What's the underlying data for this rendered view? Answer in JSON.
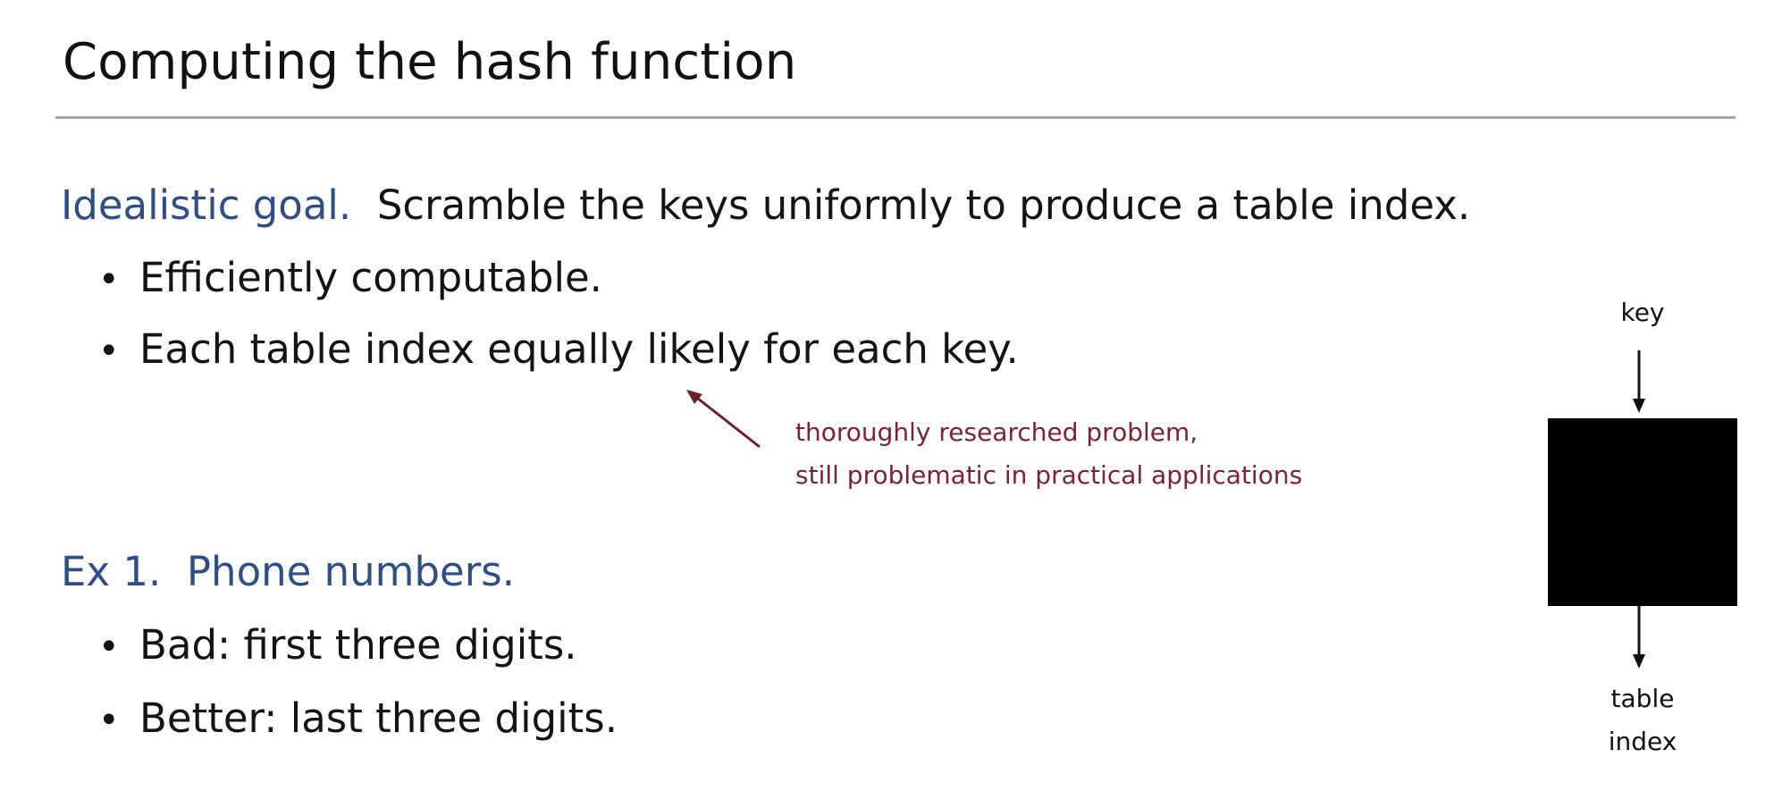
{
  "slide": {
    "title": "Computing the hash function",
    "goal": {
      "label": "Idealistic goal.",
      "text": "Scramble the keys uniformly to produce a table index.",
      "bullets": [
        "Efficiently computable.",
        "Each table index equally likely for each key."
      ]
    },
    "note": {
      "lines": [
        "thoroughly researched problem,",
        "still problematic in practical applications"
      ]
    },
    "example": {
      "label": "Ex 1.",
      "text": "Phone numbers.",
      "bullets": [
        "Bad:  first three digits.",
        "Better:  last three digits."
      ]
    },
    "diagram": {
      "input_label": "key",
      "output_label_lines": [
        "table",
        "index"
      ]
    }
  }
}
